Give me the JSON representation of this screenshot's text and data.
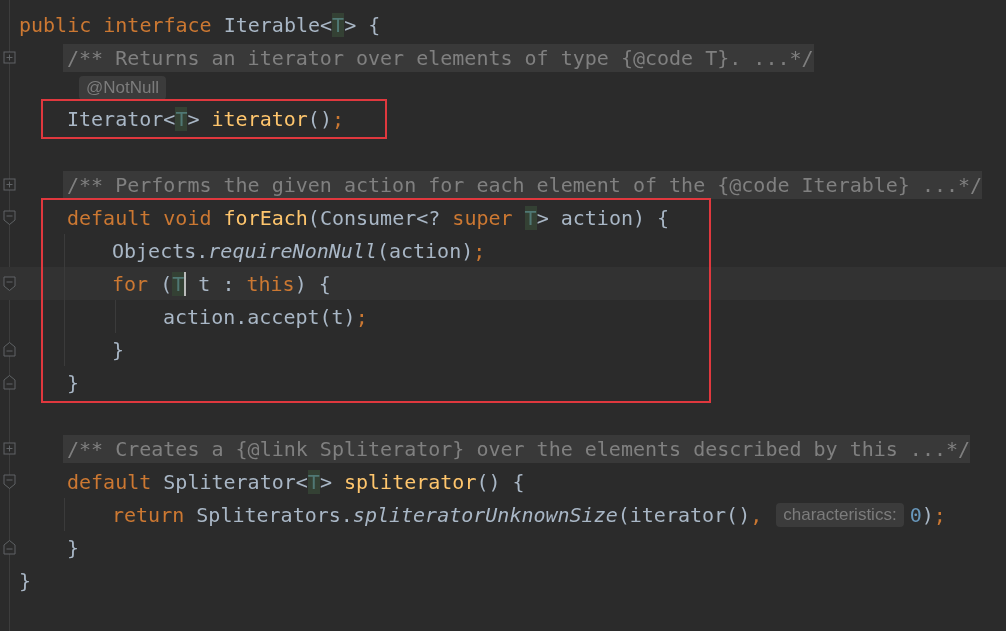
{
  "editor": {
    "blocks": [
      {
        "boxed": false,
        "lines": [
          {
            "kind": "code",
            "tokens": [
              {
                "kind": "keyword",
                "text": "public interface "
              },
              {
                "kind": "plain",
                "text": "Iterable<"
              },
              {
                "kind": "type-param",
                "text": "T"
              },
              {
                "kind": "plain",
                "text": "> {"
              }
            ]
          },
          {
            "kind": "folded",
            "tokens": [
              {
                "kind": "comment",
                "text": "    /** Returns an iterator over elements of type {@code T}. ...*/"
              }
            ]
          },
          {
            "kind": "inlay",
            "tokens": [
              {
                "kind": "hint",
                "text": "    @NotNull"
              }
            ]
          }
        ]
      },
      {
        "boxed": true,
        "lines": [
          {
            "kind": "code",
            "tokens": [
              {
                "kind": "plain",
                "text": "    Iterator<"
              },
              {
                "kind": "type-param",
                "text": "T"
              },
              {
                "kind": "plain",
                "text": "> "
              },
              {
                "kind": "method",
                "text": "iterator"
              },
              {
                "kind": "plain",
                "text": "()"
              },
              {
                "kind": "orange",
                "text": ";"
              }
            ]
          }
        ]
      },
      {
        "boxed": false,
        "lines": [
          {
            "kind": "blank"
          },
          {
            "kind": "folded",
            "tokens": [
              {
                "kind": "comment",
                "text": "    /** Performs the given action for each element of the {@code Iterable} ...*/"
              }
            ]
          }
        ]
      },
      {
        "boxed": true,
        "lines": [
          {
            "kind": "fold-start",
            "tokens": [
              {
                "kind": "keyword",
                "text": "    default void "
              },
              {
                "kind": "method",
                "text": "forEach"
              },
              {
                "kind": "plain",
                "text": "(Consumer<? "
              },
              {
                "kind": "keyword",
                "text": "super "
              },
              {
                "kind": "type-param",
                "text": "T"
              },
              {
                "kind": "plain",
                "text": "> action) {"
              }
            ]
          },
          {
            "kind": "code",
            "tokens": [
              {
                "kind": "plain",
                "text": "        Objects."
              },
              {
                "kind": "italic",
                "text": "requireNonNull"
              },
              {
                "kind": "plain",
                "text": "(action)"
              },
              {
                "kind": "orange",
                "text": ";"
              }
            ]
          },
          {
            "kind": "fold-start",
            "tokens": [
              {
                "kind": "keyword",
                "text": "        for "
              },
              {
                "kind": "plain",
                "text": "("
              },
              {
                "kind": "type-param",
                "text": "T"
              },
              {
                "kind": "caret"
              },
              {
                "kind": "plain",
                "text": " t : "
              },
              {
                "kind": "keyword",
                "text": "this"
              },
              {
                "kind": "plain",
                "text": ") {"
              }
            ]
          },
          {
            "kind": "code",
            "tokens": [
              {
                "kind": "plain",
                "text": "            action.accept(t)"
              },
              {
                "kind": "orange",
                "text": ";"
              }
            ]
          },
          {
            "kind": "fold-end",
            "tokens": [
              {
                "kind": "plain",
                "text": "        }"
              }
            ]
          },
          {
            "kind": "fold-end",
            "tokens": [
              {
                "kind": "plain",
                "text": "    }"
              }
            ]
          }
        ]
      },
      {
        "boxed": false,
        "lines": [
          {
            "kind": "blank"
          },
          {
            "kind": "folded",
            "tokens": [
              {
                "kind": "comment",
                "text": "    /** Creates a {@link Spliterator} over the elements described by this ...*/"
              }
            ]
          },
          {
            "kind": "fold-start",
            "tokens": [
              {
                "kind": "keyword",
                "text": "    default "
              },
              {
                "kind": "plain",
                "text": "Spliterator<"
              },
              {
                "kind": "type-param",
                "text": "T"
              },
              {
                "kind": "plain",
                "text": "> "
              },
              {
                "kind": "method",
                "text": "spliterator"
              },
              {
                "kind": "plain",
                "text": "() {"
              }
            ]
          },
          {
            "kind": "code",
            "tokens": [
              {
                "kind": "keyword",
                "text": "        return "
              },
              {
                "kind": "plain",
                "text": "Spliterators."
              },
              {
                "kind": "italic",
                "text": "spliteratorUnknownSize"
              },
              {
                "kind": "plain",
                "text": "(iterator()"
              },
              {
                "kind": "orange",
                "text": ","
              },
              {
                "kind": "hint",
                "text": "characteristics:"
              },
              {
                "kind": "number",
                "text": "0"
              },
              {
                "kind": "plain",
                "text": ")"
              },
              {
                "kind": "orange",
                "text": ";"
              }
            ]
          },
          {
            "kind": "fold-end",
            "tokens": [
              {
                "kind": "plain",
                "text": "    }"
              }
            ]
          },
          {
            "kind": "code",
            "tokens": [
              {
                "kind": "plain",
                "text": "}"
              }
            ]
          }
        ]
      }
    ]
  }
}
